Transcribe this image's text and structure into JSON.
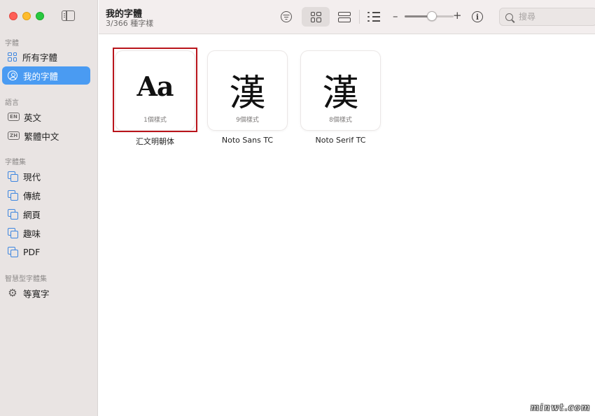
{
  "toolbar": {
    "title": "我的字體",
    "subtitle": "3/366 種字樣",
    "zoom_minus": "–",
    "zoom_plus": "+",
    "zoom_level": 0.55,
    "search_placeholder": "搜尋",
    "view_mode_active": "grid"
  },
  "sidebar": {
    "sections": [
      {
        "label": "字體",
        "items": [
          {
            "label": "所有字體",
            "icon": "grid-icon"
          },
          {
            "label": "我的字體",
            "icon": "person-circle-icon",
            "selected": true
          }
        ]
      },
      {
        "label": "語言",
        "items": [
          {
            "label": "英文",
            "icon": "en-badge-icon",
            "badge": "EN"
          },
          {
            "label": "繁體中文",
            "icon": "zh-badge-icon",
            "badge": "ZH"
          }
        ]
      },
      {
        "label": "字體集",
        "items": [
          {
            "label": "現代",
            "icon": "collection-icon"
          },
          {
            "label": "傳統",
            "icon": "collection-icon"
          },
          {
            "label": "網頁",
            "icon": "collection-icon"
          },
          {
            "label": "趣味",
            "icon": "collection-icon"
          },
          {
            "label": "PDF",
            "icon": "collection-icon"
          }
        ]
      },
      {
        "label": "智慧型字體集",
        "items": [
          {
            "label": "等寬字",
            "icon": "gear-icon"
          }
        ]
      }
    ]
  },
  "fonts": [
    {
      "glyph": "Aa",
      "styles": "1個樣式",
      "name": "汇文明朝体",
      "highlighted": true
    },
    {
      "glyph": "漢",
      "styles": "9個樣式",
      "name": "Noto Sans TC"
    },
    {
      "glyph": "漢",
      "styles": "8個樣式",
      "name": "Noto Serif TC"
    }
  ],
  "watermark": "minwt.com",
  "colors": {
    "selection": "#4a9bf2",
    "highlight_box": "#b9141b",
    "sidebar_bg": "#e9e4e3",
    "accent_icon": "#3d86e0"
  }
}
